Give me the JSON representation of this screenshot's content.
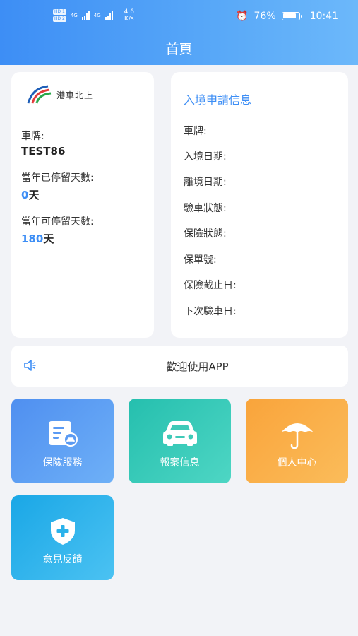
{
  "status_bar": {
    "sim1": "HD 1",
    "sim2": "HD 2",
    "net1": "4G",
    "net2": "4G",
    "speed_value": "4.6",
    "speed_unit": "K/s",
    "battery": "76%",
    "time": "10:41"
  },
  "header": {
    "title": "首頁"
  },
  "vehicle": {
    "logo_text": "港車北上",
    "plate_label": "車牌:",
    "plate_value": "TEST86",
    "stayed_label": "當年已停留天數:",
    "stayed_value": "0",
    "stayed_unit": "天",
    "allowed_label": "當年可停留天數:",
    "allowed_value": "180",
    "allowed_unit": "天"
  },
  "entry": {
    "title": "入境申請信息",
    "rows": [
      "車牌:",
      "入境日期:",
      "離境日期:",
      "驗車狀態:",
      "保險狀態:",
      "保單號:",
      "保險截止日:",
      "下次驗車日:"
    ]
  },
  "notice": {
    "text": "歡迎使用APP",
    "icon": "speaker-icon"
  },
  "tiles": [
    {
      "label": "保險服務",
      "icon": "insurance-doc-icon",
      "color": "#4f8ff0"
    },
    {
      "label": "報案信息",
      "icon": "car-icon",
      "color": "#25bfae"
    },
    {
      "label": "個人中心",
      "icon": "umbrella-icon",
      "color": "#f9a43b"
    },
    {
      "label": "意見反饋",
      "icon": "shield-plus-icon",
      "color": "#1aa7e6"
    }
  ]
}
